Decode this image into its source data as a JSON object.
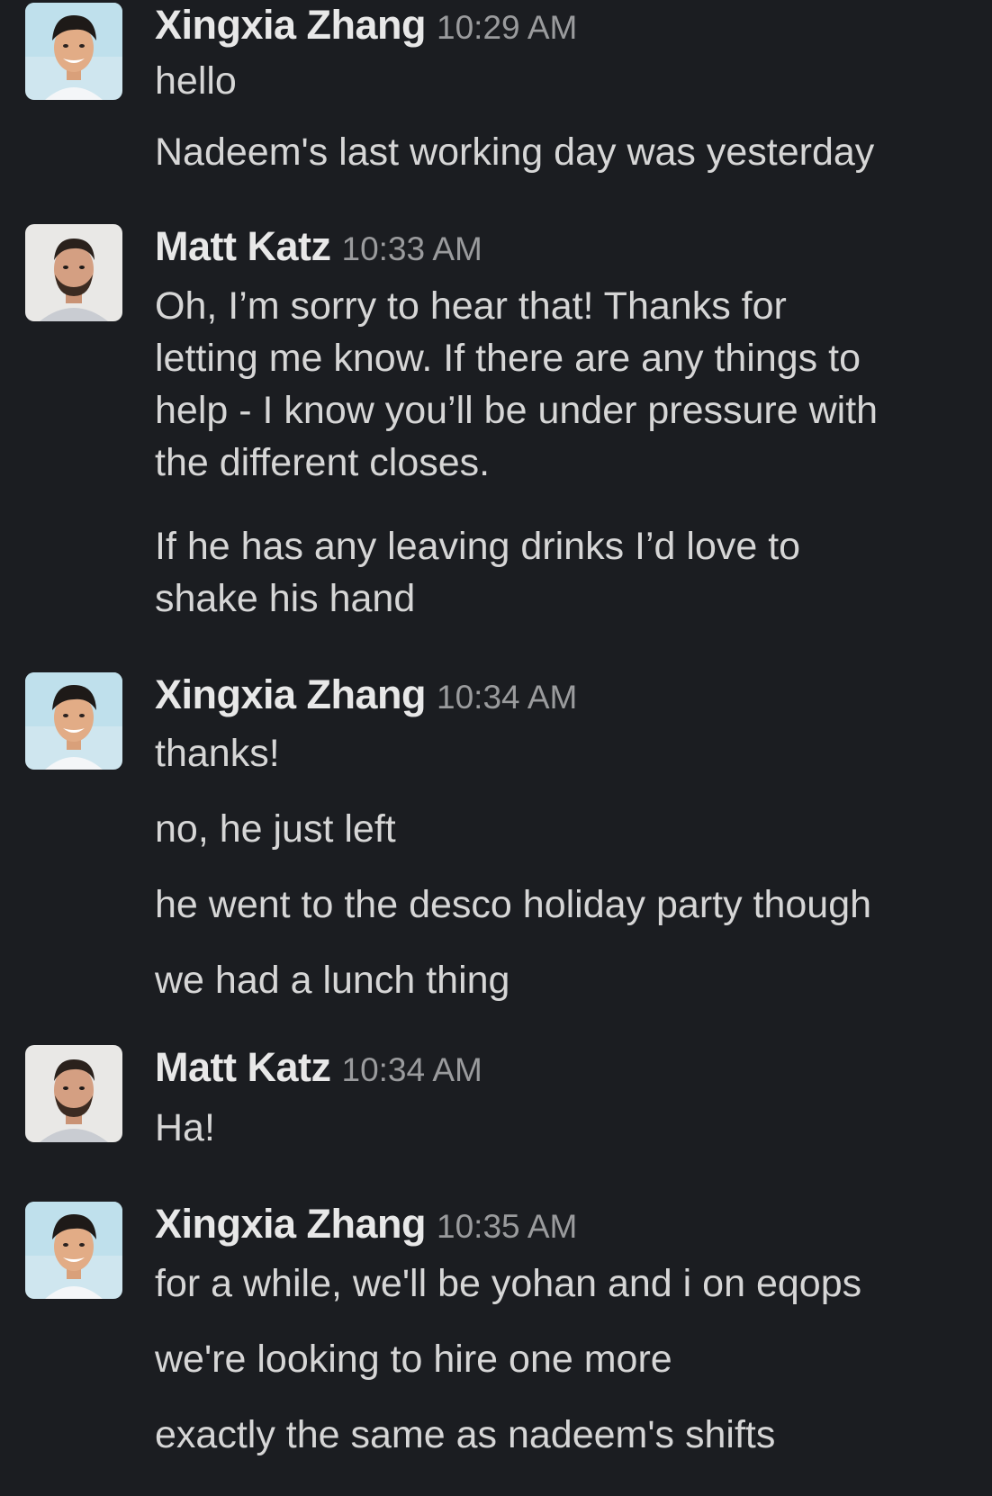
{
  "conversation": [
    {
      "author": "Xingxia Zhang",
      "time": "10:29 AM",
      "avatar_icon": "person-woman-avatar",
      "lines": [
        "hello",
        "Nadeem's last working day was yesterday"
      ]
    },
    {
      "author": "Matt Katz",
      "time": "10:33 AM",
      "avatar_icon": "person-man-avatar",
      "lines": [
        "Oh, I’m sorry to hear that! Thanks for",
        "letting me know. If there are any things to",
        "help - I know you’ll be under pressure with",
        "the different closes.",
        "If he has any leaving drinks I’d love to",
        "shake his hand"
      ]
    },
    {
      "author": "Xingxia Zhang",
      "time": "10:34 AM",
      "avatar_icon": "person-woman-avatar",
      "lines": [
        "thanks!",
        "no, he just left",
        "he went to the desco holiday party though",
        "we had a lunch thing"
      ]
    },
    {
      "author": "Matt Katz",
      "time": "10:34 AM",
      "avatar_icon": "person-man-avatar",
      "lines": [
        "Ha!"
      ]
    },
    {
      "author": "Xingxia Zhang",
      "time": "10:35 AM",
      "avatar_icon": "person-woman-avatar",
      "lines": [
        "for a while, we'll be yohan and i on eqops",
        "we're looking to hire one more",
        "exactly the same as nadeem's shifts"
      ]
    }
  ],
  "colors": {
    "background": "#1b1d21",
    "name": "#e8e8e8",
    "timestamp": "#9a9b9d",
    "message_text": "#d6d6d6"
  }
}
